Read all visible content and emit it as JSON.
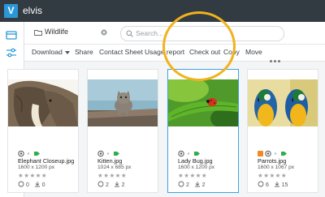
{
  "app": {
    "name": "elvis",
    "logo_letter": "V"
  },
  "folder": {
    "name": "Wildlife"
  },
  "search": {
    "placeholder": "Search..."
  },
  "toolbar": {
    "download": "Download",
    "share": "Share",
    "contact_sheet": "Contact Sheet",
    "usage_report": "Usage report",
    "check_out": "Check out",
    "copy": "Copy",
    "move": "Move"
  },
  "assets": [
    {
      "name": "Elephant Closeup.jpg",
      "dims": "1600 x 1200 px",
      "views": "0",
      "downloads": "0",
      "stars": "★★★★★"
    },
    {
      "name": "Kitten.jpg",
      "dims": "1024 x 685 px",
      "views": "2",
      "downloads": "2",
      "stars": "★★★★★"
    },
    {
      "name": "Lady Bug.jpg",
      "dims": "1600 x 1200 px",
      "views": "2",
      "downloads": "2",
      "stars": "★★★★★"
    },
    {
      "name": "Parrots.jpg",
      "dims": "1600 x 1067 px",
      "views": "6",
      "downloads": "15",
      "stars": "★★★★★"
    }
  ],
  "colors": {
    "topbar": "#323b42",
    "accent": "#2a98d8",
    "highlight": "#f2b21d",
    "tag": "#2eae4e"
  }
}
